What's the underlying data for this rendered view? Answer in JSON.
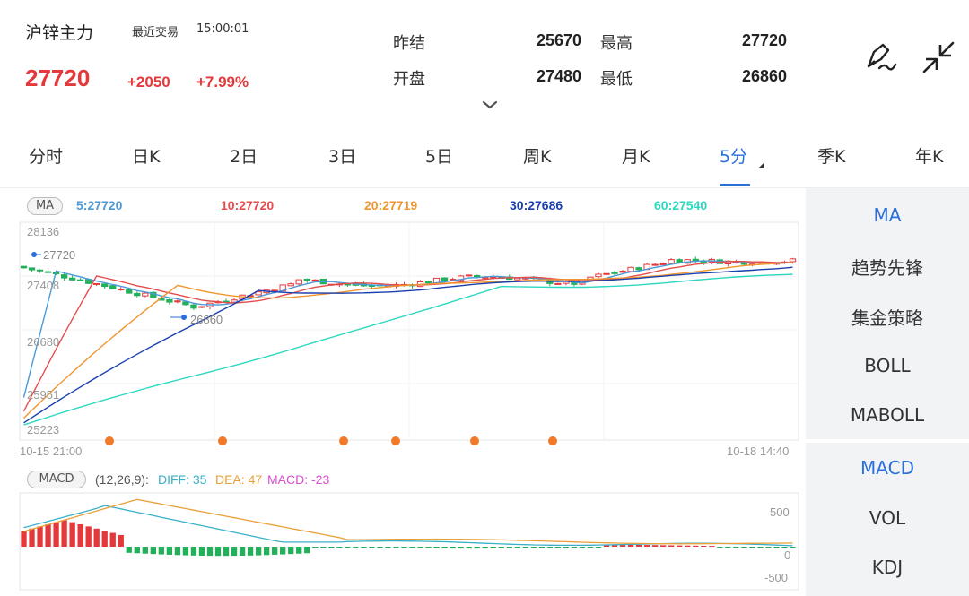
{
  "header": {
    "name": "沪锌主力",
    "trade_label": "最近交易",
    "trade_time": "15:00:01",
    "price": "27720",
    "change": "+2050",
    "change_pct": "+7.99%",
    "quote": {
      "prev_close_label": "昨结",
      "prev_close": "25670",
      "high_label": "最高",
      "high": "27720",
      "open_label": "开盘",
      "open": "27480",
      "low_label": "最低",
      "low": "26860"
    },
    "icons": [
      "draw-icon",
      "collapse-icon",
      "chevron-down-icon"
    ]
  },
  "tabs": [
    "分时",
    "日K",
    "2日",
    "3日",
    "5日",
    "周K",
    "月K",
    "5分",
    "季K",
    "年K"
  ],
  "active_tab": "5分",
  "ma": {
    "badge": "MA",
    "ma5": "5:27720",
    "ma10": "10:27720",
    "ma20": "20:27719",
    "ma30": "30:27686",
    "ma60": "60:27540",
    "colors": {
      "ma5": "#4a9ad8",
      "ma10": "#e54d4d",
      "ma20": "#f0962e",
      "ma30": "#1a3fae",
      "ma60": "#2ed8c0"
    }
  },
  "price_axis": [
    "28136",
    "27408",
    "26680",
    "25951",
    "25223"
  ],
  "markers": {
    "high": "27720",
    "low": "26860"
  },
  "time_axis": {
    "start": "10-15 21:00",
    "end": "10-18 14:40"
  },
  "macd": {
    "badge": "MACD",
    "params": "(12,26,9):",
    "diff": "DIFF: 35",
    "dea": "DEA: 47",
    "macd": "MACD: -23",
    "axis": [
      "500",
      "0",
      "-500"
    ]
  },
  "panel": {
    "top": [
      "MA",
      "趋势先锋",
      "集金策略",
      "BOLL",
      "MABOLL"
    ],
    "bottom": [
      "MACD",
      "VOL",
      "KDJ"
    ],
    "active_top": "MA",
    "active_bottom": "MACD"
  },
  "colors": {
    "up": "#e5383b",
    "down": "#22b05a",
    "accent": "#2a6fdb",
    "diff": "#3ab0c8",
    "dea": "#e8a13a"
  },
  "chart_data": {
    "type": "candlestick",
    "title": "",
    "xlabel": "",
    "ylabel": "",
    "ylim": [
      25223,
      28136
    ],
    "yticks": [
      28136,
      27408,
      26680,
      25951,
      25223
    ],
    "x_range": [
      "10-15 21:00",
      "10-18 14:40"
    ],
    "high": 27720,
    "low": 26860,
    "last_close": 27720,
    "ma_series": [
      {
        "name": "MA5",
        "last": 27720
      },
      {
        "name": "MA10",
        "last": 27720
      },
      {
        "name": "MA20",
        "last": 27719
      },
      {
        "name": "MA30",
        "last": 27686
      },
      {
        "name": "MA60",
        "last": 27540
      }
    ],
    "macd_ylim": [
      -500,
      500
    ],
    "macd_params": [
      12,
      26,
      9
    ],
    "diff": 35,
    "dea": 47,
    "macd": -23
  }
}
